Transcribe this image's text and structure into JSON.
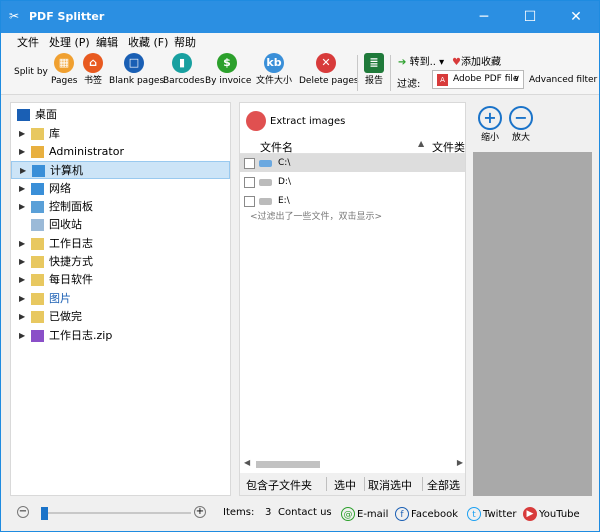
{
  "window": {
    "title": "PDF Splitter",
    "minimize": "─",
    "maximize": "☐",
    "close": "✕"
  },
  "menu": [
    "文件",
    "处理 (P)",
    "编辑",
    "收藏 (F)",
    "帮助"
  ],
  "toolbar": {
    "split_by": "Split by",
    "buttons": [
      {
        "label": "Pages",
        "color": "#f0a030",
        "glyph": "▦"
      },
      {
        "label": "书签",
        "color": "#e85a20",
        "glyph": "⌂"
      },
      {
        "label": "Blank pages",
        "color": "#1a5fb4",
        "glyph": "□"
      },
      {
        "label": "Barcodes",
        "color": "#18a0a0",
        "glyph": "▮"
      },
      {
        "label": "By invoice",
        "color": "#2ca02c",
        "glyph": "$"
      },
      {
        "label": "文件大小",
        "color": "#3a8fd8",
        "glyph": "kb"
      },
      {
        "label": "Delete pages",
        "color": "#d83b3b",
        "glyph": "✕"
      },
      {
        "label": "报告",
        "color": "#1f7a3a",
        "glyph": "≣"
      }
    ],
    "goto": "转到..",
    "favorite": "添加收藏",
    "filter_label": "过滤:",
    "filter_value": "Adobe PDF file",
    "advanced_filter": "Advanced filter"
  },
  "tree": [
    {
      "label": "桌面"
    },
    {
      "label": "库"
    },
    {
      "label": "Administrator"
    },
    {
      "label": "计算机",
      "selected": true
    },
    {
      "label": "网络"
    },
    {
      "label": "控制面板"
    },
    {
      "label": "回收站"
    },
    {
      "label": "工作日志"
    },
    {
      "label": "快捷方式"
    },
    {
      "label": "每日软件"
    },
    {
      "label": "图片"
    },
    {
      "label": "已做完"
    },
    {
      "label": "工作日志.zip"
    }
  ],
  "middle": {
    "extract_images": "Extract images",
    "col_name": "文件名",
    "col_type": "文件类",
    "rows": [
      "C:\\",
      "D:\\",
      "E:\\"
    ],
    "filter_note": "<过滤出了一些文件，双击显示>",
    "btn_subfolders": "包含子文件夹",
    "btn_select": "选中",
    "btn_deselect": "取消选中",
    "btn_select_all": "全部选"
  },
  "right": {
    "zoom_in": "缩小",
    "zoom_out": "放大"
  },
  "status": {
    "items_label": "Items:",
    "items_count": "3",
    "contact": "Contact us",
    "email": "E-mail",
    "facebook": "Facebook",
    "twitter": "Twitter",
    "youtube": "YouTube"
  }
}
